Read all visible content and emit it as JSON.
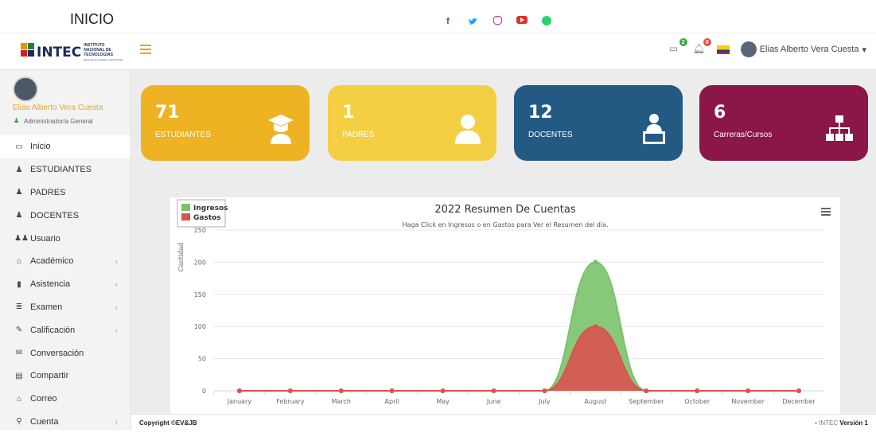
{
  "topbar": {
    "title": "INICIO"
  },
  "navbar": {
    "logo_text": "INTEC",
    "logo_subtitle": [
      "INSTITUTO",
      "NACIONAL DE",
      "TECNOLOGÍAS",
      "Recursos de la pasión, una profesión."
    ],
    "badges": {
      "messages": "2",
      "alerts": "0"
    },
    "user_name": "Elias Alberto Vera Cuesta",
    "caret": "▾"
  },
  "sidebar": {
    "profile_name": "Elias Alberto Vera Cuesta",
    "profile_role": "Administrador/a General",
    "items": [
      {
        "label": "Inicio",
        "icon": "monitor-icon",
        "chev": ""
      },
      {
        "label": "ESTUDIANTES",
        "icon": "student-icon",
        "chev": ""
      },
      {
        "label": "PADRES",
        "icon": "parent-icon",
        "chev": ""
      },
      {
        "label": "DOCENTES",
        "icon": "teacher-icon",
        "chev": ""
      },
      {
        "label": "Usuario",
        "icon": "users-icon",
        "chev": ""
      },
      {
        "label": "Académico",
        "icon": "academic-icon",
        "chev": "‹"
      },
      {
        "label": "Asistencia",
        "icon": "attendance-icon",
        "chev": "‹"
      },
      {
        "label": "Examen",
        "icon": "exam-icon",
        "chev": "‹"
      },
      {
        "label": "Calificación",
        "icon": "grade-icon",
        "chev": "‹"
      },
      {
        "label": "Conversación",
        "icon": "chat-icon",
        "chev": ""
      },
      {
        "label": "Compartir",
        "icon": "share-icon",
        "chev": ""
      },
      {
        "label": "Correo",
        "icon": "mail-icon",
        "chev": ""
      },
      {
        "label": "Cuenta",
        "icon": "account-icon",
        "chev": "‹"
      }
    ]
  },
  "cards": [
    {
      "value": "71",
      "label": "ESTUDIANTES",
      "color": "#edb322",
      "icon": "graduate-icon"
    },
    {
      "value": "1",
      "label": "PADRES",
      "color": "#f5cf43",
      "icon": "person-icon"
    },
    {
      "value": "12",
      "label": "DOCENTES",
      "color": "#235a84",
      "icon": "teacher-desk-icon"
    },
    {
      "value": "6",
      "label": "Carreras/Cursos",
      "color": "#8a1747",
      "icon": "sitemap-icon"
    }
  ],
  "chart_data": {
    "type": "area",
    "title": "2022 Resumen De Cuentas",
    "subtitle": "Haga Click en Ingresos o en Gastos para Ver el Resumen del día.",
    "xlabel": "",
    "ylabel": "Cantidad",
    "ylim": [
      0,
      250
    ],
    "yticks": [
      0,
      50,
      100,
      150,
      200,
      250
    ],
    "categories": [
      "January",
      "February",
      "March",
      "April",
      "May",
      "June",
      "July",
      "August",
      "September",
      "October",
      "November",
      "December"
    ],
    "series": [
      {
        "name": "Ingresos",
        "color": "#7ac36a",
        "values": [
          0,
          0,
          0,
          0,
          0,
          0,
          0,
          200,
          0,
          0,
          0,
          0
        ]
      },
      {
        "name": "Gastos",
        "color": "#d9534f",
        "values": [
          0,
          0,
          0,
          0,
          0,
          0,
          0,
          100,
          0,
          0,
          0,
          0
        ]
      }
    ],
    "legend": "top-left",
    "grid": true
  },
  "footer": {
    "copyright": "Copyright ©EV&JB",
    "brand": "INTEC",
    "version_label": "Versión",
    "version": "1"
  }
}
